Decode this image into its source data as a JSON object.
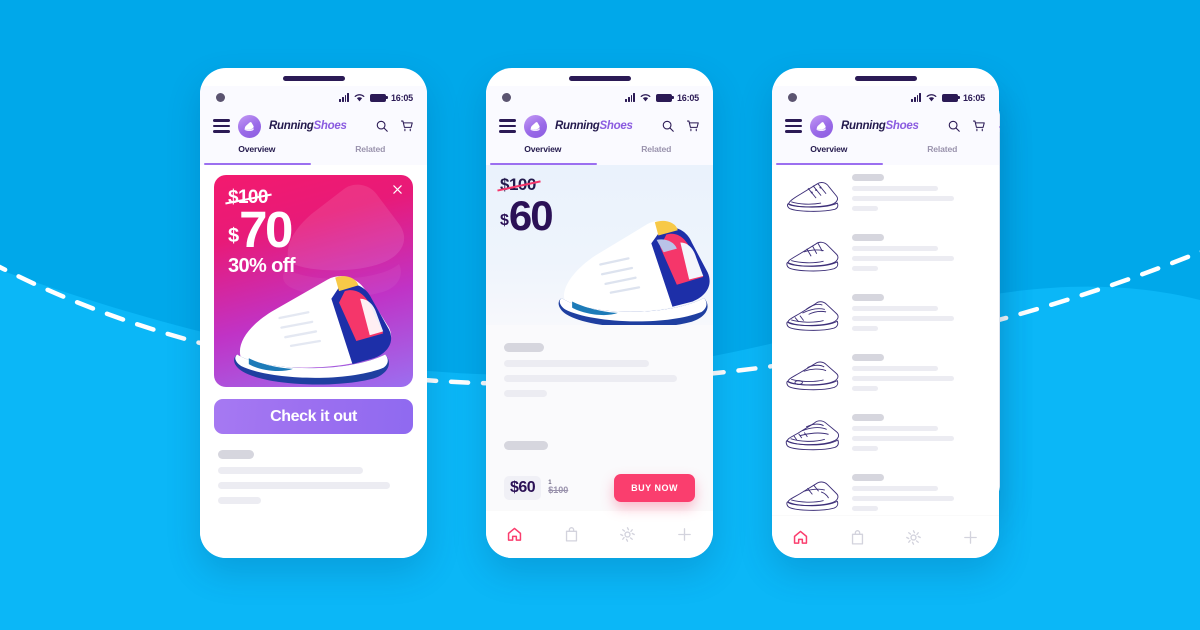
{
  "background": {
    "color_top": "#00a8ea",
    "color_bottom": "#12bdfb",
    "dash_color": "#ffffff"
  },
  "brand": {
    "name_first": "Running",
    "name_second": "Shoes",
    "logo_icon": "shoe-icon",
    "logo_color": "#8b5ce0"
  },
  "status_bar": {
    "time": "16:05",
    "signal_icon": "signal-bars-icon",
    "wifi_icon": "wifi-icon",
    "battery_icon": "battery-icon",
    "camera_icon": "front-camera-icon"
  },
  "app_bar": {
    "menu_icon": "hamburger-menu-icon",
    "search_icon": "search-icon",
    "cart_icon": "shopping-cart-icon"
  },
  "tabs": {
    "active": "Overview",
    "inactive": "Related"
  },
  "bottom_nav": {
    "items": [
      {
        "label": "Home",
        "icon": "home-icon",
        "active": true,
        "color": "#fa3e6e"
      },
      {
        "label": "Bag",
        "icon": "shopping-bag-icon",
        "active": false,
        "color": "#d3d3dd"
      },
      {
        "label": "Settings",
        "icon": "gear-icon",
        "active": false,
        "color": "#d3d3dd"
      },
      {
        "label": "Add",
        "icon": "plus-icon",
        "active": false,
        "color": "#d3d3dd"
      }
    ]
  },
  "phone1": {
    "promo": {
      "old_price": "$100",
      "currency": "$",
      "new_price": "70",
      "discount": "30% off",
      "close_icon": "close-icon",
      "gradient_from": "#f31a6e",
      "gradient_to": "#9b6ff0"
    },
    "cta_label": "Check it out"
  },
  "phone2": {
    "hero": {
      "old_price": "$100",
      "currency": "$",
      "new_price": "60",
      "strike_color": "#f5366a"
    },
    "footer": {
      "price": "$60",
      "qty": "1",
      "old_price": "$100",
      "buy_label": "BUY NOW",
      "buy_color": "#fa3e6e"
    }
  },
  "phone3": {
    "rows": [
      {
        "thumb": "sneaker-low-top-icon"
      },
      {
        "thumb": "sneaker-runner-icon"
      },
      {
        "thumb": "sneaker-trainer-icon"
      },
      {
        "thumb": "sneaker-air-icon"
      },
      {
        "thumb": "sneaker-chunky-icon"
      },
      {
        "thumb": "sneaker-classic-icon"
      }
    ]
  }
}
